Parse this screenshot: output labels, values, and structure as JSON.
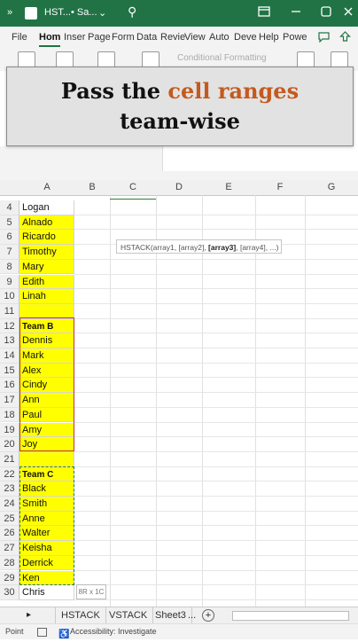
{
  "titlebar": {
    "menu_glyph": "»",
    "filename": "HST...",
    "save_state": "• Sa...",
    "dropdown": "⌄",
    "search_glyph": "⚲"
  },
  "menu": {
    "items": [
      "File",
      "Hom",
      "Inser",
      "Page",
      "Form",
      "Data",
      "Revie",
      "View",
      "Auto",
      "Deve",
      "Help",
      "Powe"
    ]
  },
  "ribbon": {
    "conditional_formatting": "Conditional Formatting"
  },
  "overlay": {
    "line1_pre": "Pass the ",
    "line1_accent": "cell ranges",
    "line2": "team-wise",
    "accent_color": "#c45a1f"
  },
  "columns": [
    "A",
    "B",
    "C",
    "D",
    "E",
    "F",
    "G"
  ],
  "rows": [
    {
      "num": "4",
      "value": "Logan",
      "yellow": false,
      "bold": false
    },
    {
      "num": "5",
      "value": "Alnado",
      "yellow": true,
      "bold": false
    },
    {
      "num": "6",
      "value": "Ricardo",
      "yellow": true,
      "bold": false
    },
    {
      "num": "7",
      "value": "Timothy",
      "yellow": true,
      "bold": false
    },
    {
      "num": "8",
      "value": "Mary",
      "yellow": true,
      "bold": false
    },
    {
      "num": "9",
      "value": "Edith",
      "yellow": true,
      "bold": false
    },
    {
      "num": "10",
      "value": "Linah",
      "yellow": true,
      "bold": false
    },
    {
      "num": "11",
      "value": "",
      "yellow": true,
      "bold": false
    },
    {
      "num": "12",
      "value": "Team B",
      "yellow": true,
      "bold": true
    },
    {
      "num": "13",
      "value": "Dennis",
      "yellow": true,
      "bold": false
    },
    {
      "num": "14",
      "value": "Mark",
      "yellow": true,
      "bold": false
    },
    {
      "num": "15",
      "value": "Alex",
      "yellow": true,
      "bold": false
    },
    {
      "num": "16",
      "value": "Cindy",
      "yellow": true,
      "bold": false
    },
    {
      "num": "17",
      "value": "Ann",
      "yellow": true,
      "bold": false
    },
    {
      "num": "18",
      "value": "Paul",
      "yellow": true,
      "bold": false
    },
    {
      "num": "19",
      "value": "Amy",
      "yellow": true,
      "bold": false
    },
    {
      "num": "20",
      "value": "Joy",
      "yellow": true,
      "bold": false
    },
    {
      "num": "21",
      "value": "",
      "yellow": true,
      "bold": false
    },
    {
      "num": "22",
      "value": "Team C",
      "yellow": true,
      "bold": true
    },
    {
      "num": "23",
      "value": "Black",
      "yellow": true,
      "bold": false
    },
    {
      "num": "24",
      "value": "Smith",
      "yellow": true,
      "bold": false
    },
    {
      "num": "25",
      "value": "Anne",
      "yellow": true,
      "bold": false
    },
    {
      "num": "26",
      "value": "Walter",
      "yellow": true,
      "bold": false
    },
    {
      "num": "27",
      "value": "Keisha",
      "yellow": true,
      "bold": false
    },
    {
      "num": "28",
      "value": "Derrick",
      "yellow": true,
      "bold": false
    },
    {
      "num": "29",
      "value": "Ken",
      "yellow": true,
      "bold": false
    },
    {
      "num": "30",
      "value": "Chris",
      "yellow": false,
      "bold": false
    }
  ],
  "tooltip": {
    "prefix": "HSTACK(array1, [array2], ",
    "current": "[array3]",
    "suffix": ", [array4], ...)"
  },
  "size_badge": "8R x 1C",
  "sheets": {
    "nav_glyph": "▸",
    "tabs": [
      "HSTACK",
      "VSTACK",
      "Sheet3"
    ],
    "more": "...",
    "add_glyph": "+"
  },
  "status": {
    "mode": "Point",
    "accessibility": "Accessibility: Investigate"
  }
}
